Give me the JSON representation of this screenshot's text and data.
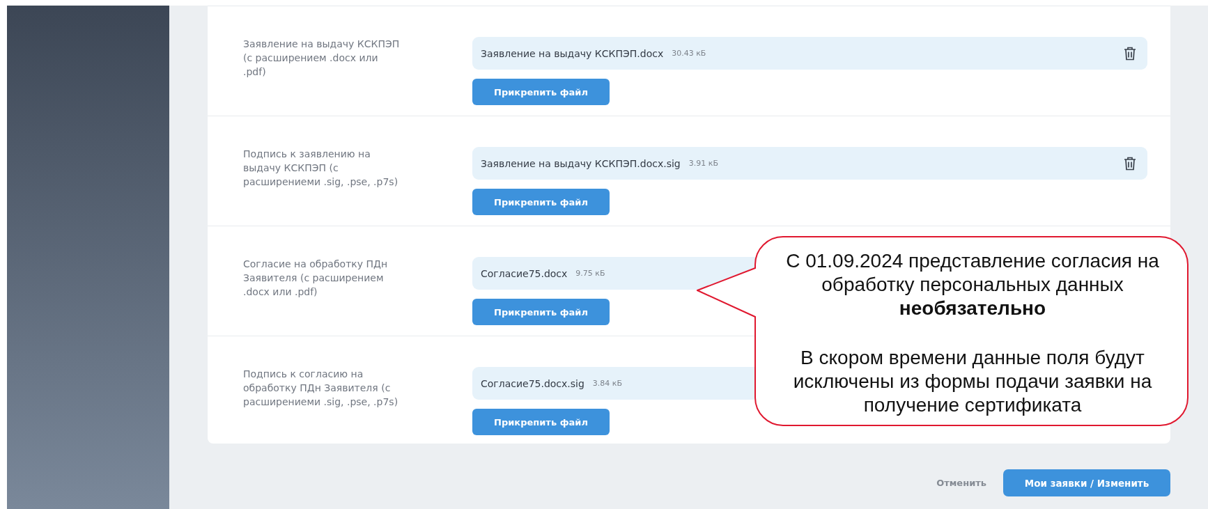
{
  "documents": [
    {
      "label": "Заявление на выдачу КСКПЭП (с расширением .docx или .pdf)",
      "file": {
        "name": "Заявление на выдачу КСКПЭП.docx",
        "size": "30.43 кБ",
        "removable": true
      },
      "attach_button": "Прикрепить файл"
    },
    {
      "label": "Подпись к заявлению на выдачу КСКПЭП (с расширениеми .sig, .pse, .p7s)",
      "file": {
        "name": "Заявление на выдачу КСКПЭП.docx.sig",
        "size": "3.91 кБ",
        "removable": true
      },
      "attach_button": "Прикрепить файл"
    },
    {
      "label": "Согласие на обработку ПДн Заявителя (с расширением .docx или .pdf)",
      "file": {
        "name": "Согласие75.docx",
        "size": "9.75 кБ"
      },
      "attach_button": "Прикрепить файл"
    },
    {
      "label": "Подпись к согласию на обработку ПДн Заявителя (с расширениеми .sig, .pse, .p7s)",
      "file": {
        "name": "Согласие75.docx.sig",
        "size": "3.84 кБ"
      },
      "attach_button": "Прикрепить файл"
    }
  ],
  "footer": {
    "cancel": "Отменить",
    "submit": "Мои заявки / Изменить"
  },
  "callout": {
    "paragraphs": [
      "С 01.09.2024 представление согласия на обработку персональных данных **необязательно**",
      "В скором времени данные поля будут исключены из формы подачи заявки на получение сертификата"
    ]
  }
}
